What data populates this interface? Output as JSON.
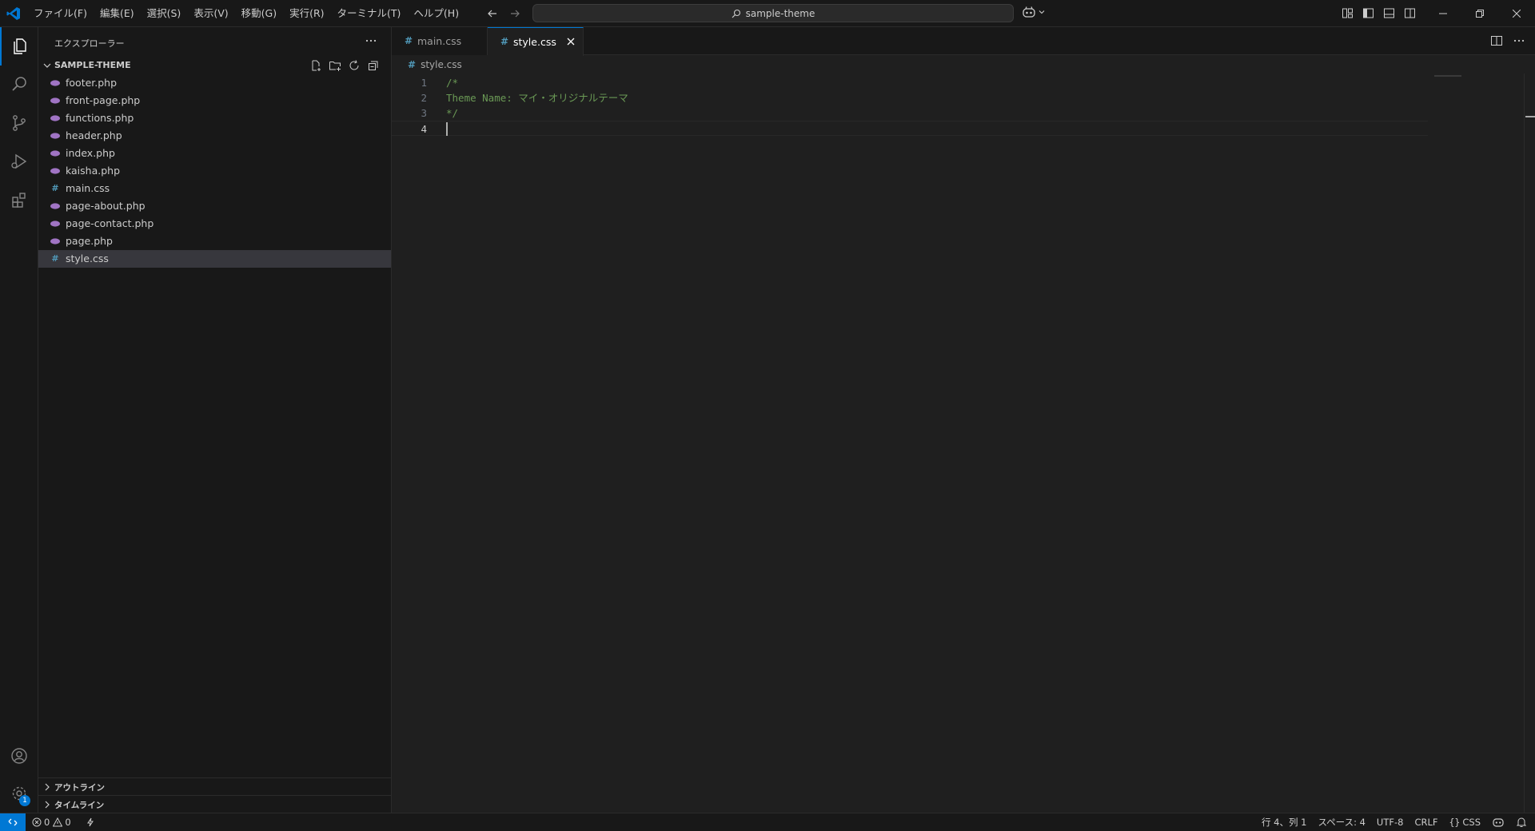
{
  "titlebar": {
    "menu": [
      "ファイル(F)",
      "編集(E)",
      "選択(S)",
      "表示(V)",
      "移動(G)",
      "実行(R)",
      "ターミナル(T)",
      "ヘルプ(H)"
    ],
    "search_text": "sample-theme"
  },
  "activity_bar": {
    "items": [
      "explorer-icon",
      "search-icon",
      "source-control-icon",
      "run-debug-icon",
      "extensions-icon"
    ],
    "bottom_items": [
      "account-icon",
      "manage-gear-icon"
    ],
    "settings_badge": "1"
  },
  "sidebar": {
    "title": "エクスプローラー",
    "folder_name": "SAMPLE-THEME",
    "files": [
      {
        "name": "footer.php",
        "type": "php"
      },
      {
        "name": "front-page.php",
        "type": "php"
      },
      {
        "name": "functions.php",
        "type": "php"
      },
      {
        "name": "header.php",
        "type": "php"
      },
      {
        "name": "index.php",
        "type": "php"
      },
      {
        "name": "kaisha.php",
        "type": "php"
      },
      {
        "name": "main.css",
        "type": "css"
      },
      {
        "name": "page-about.php",
        "type": "php"
      },
      {
        "name": "page-contact.php",
        "type": "php"
      },
      {
        "name": "page.php",
        "type": "php"
      },
      {
        "name": "style.css",
        "type": "css",
        "selected": true
      }
    ],
    "outline_label": "アウトライン",
    "timeline_label": "タイムライン"
  },
  "editor": {
    "tabs": [
      {
        "label": "main.css",
        "active": false
      },
      {
        "label": "style.css",
        "active": true
      }
    ],
    "breadcrumb": "style.css",
    "lines": [
      {
        "num": "1",
        "text": "/*"
      },
      {
        "num": "2",
        "text": "Theme Name: マイ・オリジナルテーマ"
      },
      {
        "num": "3",
        "text": "*/"
      },
      {
        "num": "4",
        "text": ""
      }
    ],
    "current_line": 4
  },
  "statusbar": {
    "errors": "0",
    "warnings": "0",
    "position": "行 4、列 1",
    "spaces": "スペース: 4",
    "encoding": "UTF-8",
    "eol": "CRLF",
    "language": "CSS"
  },
  "colors": {
    "accent": "#0078d4",
    "php_icon": "#a074c4",
    "css_icon": "#519aba",
    "comment": "#6a9955"
  }
}
